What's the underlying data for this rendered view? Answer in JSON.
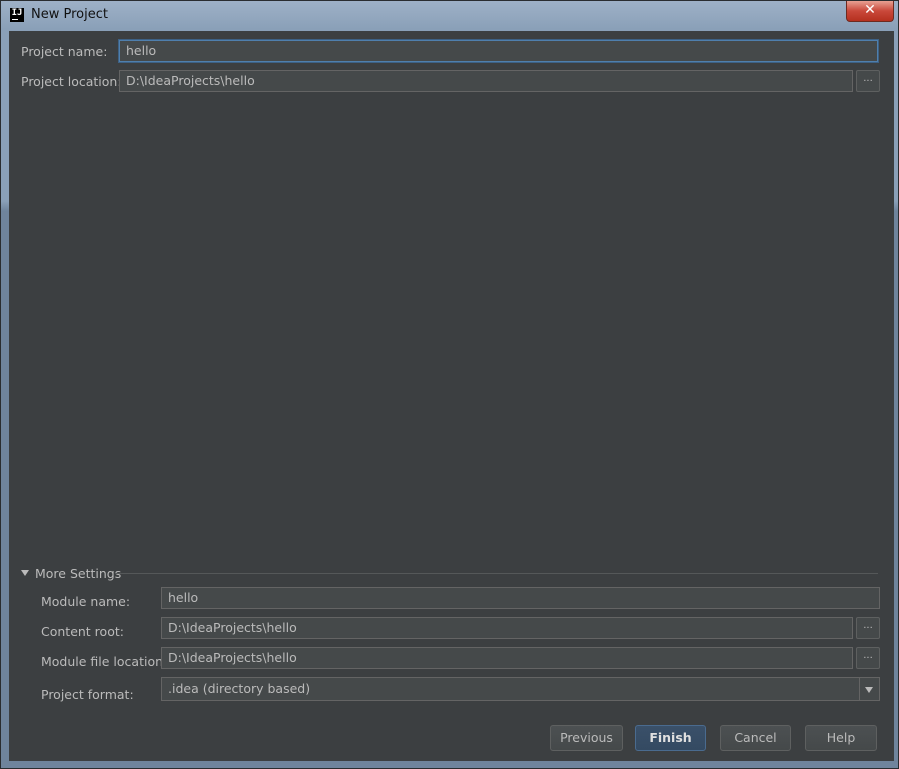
{
  "window": {
    "title": "New Project",
    "icon_text": "IJ",
    "close_glyph": "✕"
  },
  "project": {
    "name_label": "Project name:",
    "name_value": "hello",
    "location_label": "Project location:",
    "location_value": "D:\\IdeaProjects\\hello",
    "browse_glyph": "..."
  },
  "more_settings": {
    "header": "More Settings",
    "module_name_label": "Module name:",
    "module_name_value": "hello",
    "content_root_label": "Content root:",
    "content_root_value": "D:\\IdeaProjects\\hello",
    "module_file_label": "Module file location:",
    "module_file_value": "D:\\IdeaProjects\\hello",
    "format_label": "Project format:",
    "format_value": ".idea (directory based)"
  },
  "buttons": {
    "previous": "Previous",
    "finish": "Finish",
    "cancel": "Cancel",
    "help": "Help"
  },
  "colors": {
    "background": "#3c3f41",
    "field": "#45494a",
    "focus_border": "#4f7fad",
    "text": "#bbbbbb"
  }
}
